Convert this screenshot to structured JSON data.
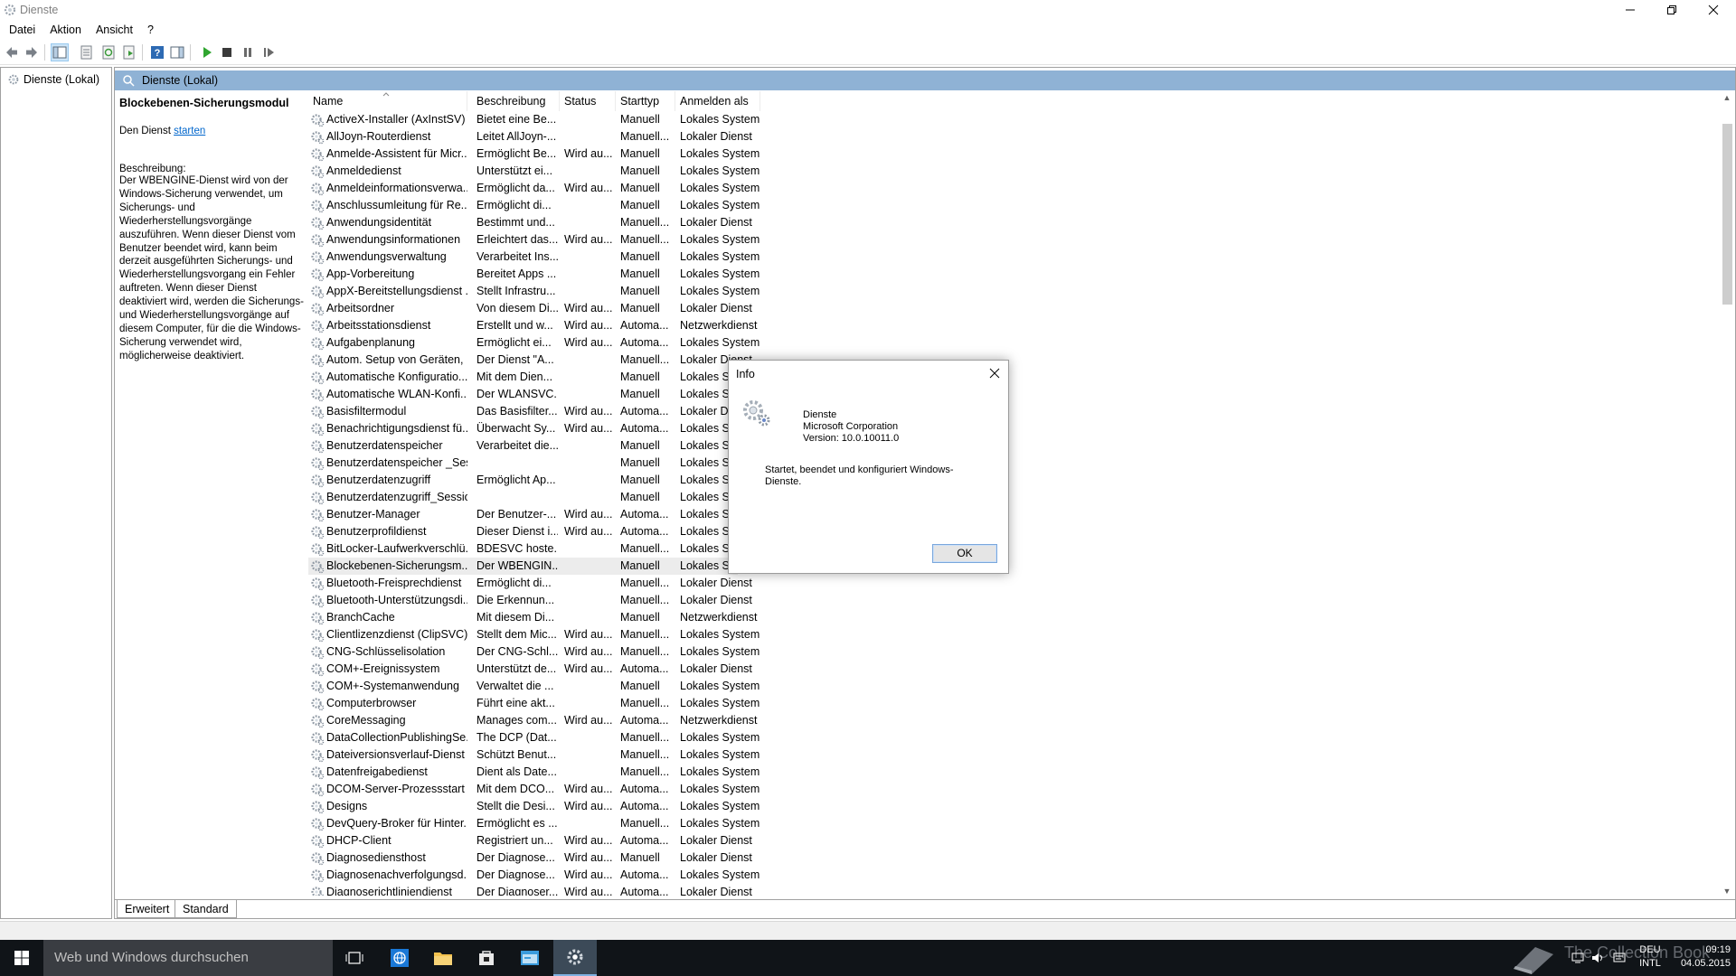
{
  "window": {
    "title": "Dienste"
  },
  "menu": [
    "Datei",
    "Aktion",
    "Ansicht",
    "?"
  ],
  "tree": {
    "root_label": "Dienste (Lokal)"
  },
  "header": {
    "title": "Dienste (Lokal)"
  },
  "detail": {
    "service_title": "Blockebenen-Sicherungsmodul",
    "action_prefix": "Den Dienst",
    "action_link": "starten",
    "description_label": "Beschreibung:",
    "description": "Der WBENGINE-Dienst wird von der Windows-Sicherung verwendet, um Sicherungs- und Wiederherstellungsvorgänge auszuführen. Wenn dieser Dienst vom Benutzer beendet wird, kann beim derzeit ausgeführten Sicherungs- und Wiederherstellungsvorgang ein Fehler auftreten. Wenn dieser Dienst deaktiviert wird, werden die Sicherungs- und Wiederherstellungsvorgänge auf diesem Computer, für die die Windows-Sicherung verwendet wird, möglicherweise deaktiviert."
  },
  "columns": [
    "Name",
    "Beschreibung",
    "Status",
    "Starttyp",
    "Anmelden als"
  ],
  "services": [
    {
      "name": "ActiveX-Installer (AxInstSV)",
      "desc": "Bietet eine Be...",
      "status": "",
      "start": "Manuell",
      "logon": "Lokales System"
    },
    {
      "name": "AllJoyn-Routerdienst",
      "desc": "Leitet AllJoyn-...",
      "status": "",
      "start": "Manuell...",
      "logon": "Lokaler Dienst"
    },
    {
      "name": "Anmelde-Assistent für Micr...",
      "desc": "Ermöglicht Be...",
      "status": "Wird au...",
      "start": "Manuell",
      "logon": "Lokales System"
    },
    {
      "name": "Anmeldedienst",
      "desc": "Unterstützt ei...",
      "status": "",
      "start": "Manuell",
      "logon": "Lokales System"
    },
    {
      "name": "Anmeldeinformationsverwa...",
      "desc": "Ermöglicht da...",
      "status": "Wird au...",
      "start": "Manuell",
      "logon": "Lokales System"
    },
    {
      "name": "Anschlussumleitung für Re...",
      "desc": "Ermöglicht di...",
      "status": "",
      "start": "Manuell",
      "logon": "Lokales System"
    },
    {
      "name": "Anwendungsidentität",
      "desc": "Bestimmt und...",
      "status": "",
      "start": "Manuell...",
      "logon": "Lokaler Dienst"
    },
    {
      "name": "Anwendungsinformationen",
      "desc": "Erleichtert das...",
      "status": "Wird au...",
      "start": "Manuell...",
      "logon": "Lokales System"
    },
    {
      "name": "Anwendungsverwaltung",
      "desc": "Verarbeitet Ins...",
      "status": "",
      "start": "Manuell",
      "logon": "Lokales System"
    },
    {
      "name": "App-Vorbereitung",
      "desc": "Bereitet Apps ...",
      "status": "",
      "start": "Manuell",
      "logon": "Lokales System"
    },
    {
      "name": "AppX-Bereitstellungsdienst ...",
      "desc": "Stellt Infrastru...",
      "status": "",
      "start": "Manuell",
      "logon": "Lokales System"
    },
    {
      "name": "Arbeitsordner",
      "desc": "Von diesem Di...",
      "status": "Wird au...",
      "start": "Manuell",
      "logon": "Lokaler Dienst"
    },
    {
      "name": "Arbeitsstationsdienst",
      "desc": "Erstellt und w...",
      "status": "Wird au...",
      "start": "Automa...",
      "logon": "Netzwerkdienst"
    },
    {
      "name": "Aufgabenplanung",
      "desc": "Ermöglicht ei...",
      "status": "Wird au...",
      "start": "Automa...",
      "logon": "Lokales System"
    },
    {
      "name": "Autom. Setup von Geräten, ...",
      "desc": "Der Dienst \"A...",
      "status": "",
      "start": "Manuell...",
      "logon": "Lokaler Dienst"
    },
    {
      "name": "Automatische Konfiguratio...",
      "desc": "Mit dem Dien...",
      "status": "",
      "start": "Manuell",
      "logon": "Lokales System"
    },
    {
      "name": "Automatische WLAN-Konfi...",
      "desc": "Der WLANSVC...",
      "status": "",
      "start": "Manuell",
      "logon": "Lokales System"
    },
    {
      "name": "Basisfiltermodul",
      "desc": "Das Basisfilter...",
      "status": "Wird au...",
      "start": "Automa...",
      "logon": "Lokaler Dienst"
    },
    {
      "name": "Benachrichtigungsdienst fü...",
      "desc": "Überwacht Sy...",
      "status": "Wird au...",
      "start": "Automa...",
      "logon": "Lokales System"
    },
    {
      "name": "Benutzerdatenspeicher",
      "desc": "Verarbeitet die...",
      "status": "",
      "start": "Manuell",
      "logon": "Lokales System"
    },
    {
      "name": "Benutzerdatenspeicher _Ses...",
      "desc": "",
      "status": "",
      "start": "Manuell",
      "logon": "Lokales System"
    },
    {
      "name": "Benutzerdatenzugriff",
      "desc": "Ermöglicht Ap...",
      "status": "",
      "start": "Manuell",
      "logon": "Lokales System"
    },
    {
      "name": "Benutzerdatenzugriff_Sessio...",
      "desc": "",
      "status": "",
      "start": "Manuell",
      "logon": "Lokales System"
    },
    {
      "name": "Benutzer-Manager",
      "desc": "Der Benutzer-...",
      "status": "Wird au...",
      "start": "Automa...",
      "logon": "Lokales System"
    },
    {
      "name": "Benutzerprofildienst",
      "desc": "Dieser Dienst i...",
      "status": "Wird au...",
      "start": "Automa...",
      "logon": "Lokales System"
    },
    {
      "name": "BitLocker-Laufwerkverschlü...",
      "desc": "BDESVC hoste...",
      "status": "",
      "start": "Manuell...",
      "logon": "Lokales System"
    },
    {
      "name": "Blockebenen-Sicherungsm...",
      "desc": "Der WBENGIN...",
      "status": "",
      "start": "Manuell",
      "logon": "Lokales System",
      "selected": true
    },
    {
      "name": "Bluetooth-Freisprechdienst",
      "desc": "Ermöglicht di...",
      "status": "",
      "start": "Manuell...",
      "logon": "Lokaler Dienst"
    },
    {
      "name": "Bluetooth-Unterstützungsdi...",
      "desc": "Die Erkennun...",
      "status": "",
      "start": "Manuell...",
      "logon": "Lokaler Dienst"
    },
    {
      "name": "BranchCache",
      "desc": "Mit diesem Di...",
      "status": "",
      "start": "Manuell",
      "logon": "Netzwerkdienst"
    },
    {
      "name": "Clientlizenzdienst (ClipSVC)",
      "desc": "Stellt dem Mic...",
      "status": "Wird au...",
      "start": "Manuell...",
      "logon": "Lokales System"
    },
    {
      "name": "CNG-Schlüsselisolation",
      "desc": "Der CNG-Schl...",
      "status": "Wird au...",
      "start": "Manuell...",
      "logon": "Lokales System"
    },
    {
      "name": "COM+-Ereignissystem",
      "desc": "Unterstützt de...",
      "status": "Wird au...",
      "start": "Automa...",
      "logon": "Lokaler Dienst"
    },
    {
      "name": "COM+-Systemanwendung",
      "desc": "Verwaltet die ...",
      "status": "",
      "start": "Manuell",
      "logon": "Lokales System"
    },
    {
      "name": "Computerbrowser",
      "desc": "Führt eine akt...",
      "status": "",
      "start": "Manuell...",
      "logon": "Lokales System"
    },
    {
      "name": "CoreMessaging",
      "desc": "Manages com...",
      "status": "Wird au...",
      "start": "Automa...",
      "logon": "Netzwerkdienst"
    },
    {
      "name": "DataCollectionPublishingSe...",
      "desc": "The DCP (Dat...",
      "status": "",
      "start": "Manuell...",
      "logon": "Lokales System"
    },
    {
      "name": "Dateiversionsverlauf-Dienst",
      "desc": "Schützt Benut...",
      "status": "",
      "start": "Manuell...",
      "logon": "Lokales System"
    },
    {
      "name": "Datenfreigabedienst",
      "desc": "Dient als Date...",
      "status": "",
      "start": "Manuell...",
      "logon": "Lokales System"
    },
    {
      "name": "DCOM-Server-Prozessstart",
      "desc": "Mit dem DCO...",
      "status": "Wird au...",
      "start": "Automa...",
      "logon": "Lokales System"
    },
    {
      "name": "Designs",
      "desc": "Stellt die Desi...",
      "status": "Wird au...",
      "start": "Automa...",
      "logon": "Lokales System"
    },
    {
      "name": "DevQuery-Broker für Hinter...",
      "desc": "Ermöglicht es ...",
      "status": "",
      "start": "Manuell...",
      "logon": "Lokales System"
    },
    {
      "name": "DHCP-Client",
      "desc": "Registriert un...",
      "status": "Wird au...",
      "start": "Automa...",
      "logon": "Lokaler Dienst"
    },
    {
      "name": "Diagnosediensthost",
      "desc": "Der Diagnose...",
      "status": "Wird au...",
      "start": "Manuell",
      "logon": "Lokaler Dienst"
    },
    {
      "name": "Diagnosenachverfolgungsd...",
      "desc": "Der Diagnose...",
      "status": "Wird au...",
      "start": "Automa...",
      "logon": "Lokales System"
    },
    {
      "name": "Diagnoserichtliniendienst",
      "desc": "Der Diagnoser...",
      "status": "Wird au...",
      "start": "Automa...",
      "logon": "Lokaler Dienst"
    }
  ],
  "tabs": [
    "Erweitert",
    "Standard"
  ],
  "dialog": {
    "title": "Info",
    "app_name": "Dienste",
    "company": "Microsoft Corporation",
    "version": "Version: 10.0.10011.0",
    "description": "Startet, beendet und konfiguriert Windows-Dienste.",
    "ok_label": "OK"
  },
  "taskbar": {
    "search_placeholder": "Web und Windows durchsuchen",
    "language": "DEU",
    "keyboard": "INTL",
    "time": "09:19",
    "date": "04.05.2015",
    "watermark": "The Collection Book"
  },
  "colors": {
    "header_blue": "#8fb2d5",
    "link_blue": "#0066cc",
    "taskbar": "#101418"
  }
}
